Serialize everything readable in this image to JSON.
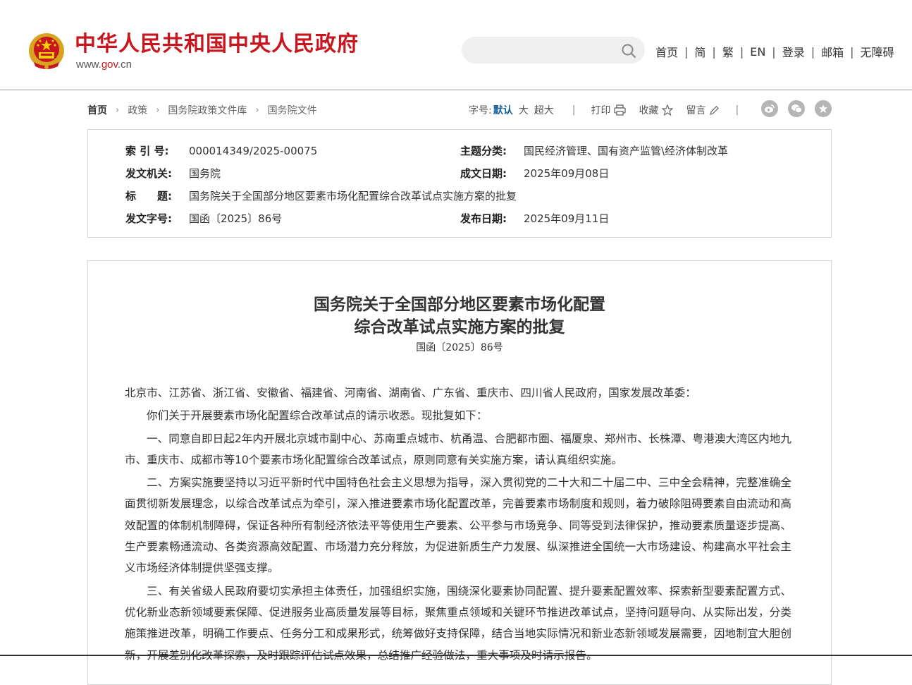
{
  "header": {
    "site_name": "中华人民共和国中央人民政府",
    "url_prefix": "www.",
    "url_gov": "gov",
    "url_suffix": ".cn",
    "search_placeholder": "",
    "nav": [
      "首页",
      "简",
      "繁",
      "EN",
      "登录",
      "邮箱",
      "无障碍"
    ],
    "brand_color": "#c8161e"
  },
  "breadcrumb": [
    "首页",
    "政策",
    "国务院政策文件库",
    "国务院文件"
  ],
  "tools": {
    "font_size_label": "字号:",
    "font_size_default": "默认",
    "font_size_large": "大",
    "font_size_xlarge": "超大",
    "print": "打印",
    "favorite": "收藏",
    "comment": "留言",
    "share_icons": [
      "weibo-icon",
      "wechat-icon",
      "star-share-icon"
    ]
  },
  "meta": {
    "index_no_label": "索 引 号:",
    "index_no": "000014349/2025-00075",
    "topic_label": "主题分类:",
    "topic": "国民经济管理、国有资产监管\\经济体制改革",
    "issuer_label": "发文机关:",
    "issuer": "国务院",
    "written_date_label": "成文日期:",
    "written_date": "2025年09月08日",
    "title_label": "标　　题:",
    "title": "国务院关于全国部分地区要素市场化配置综合改革试点实施方案的批复",
    "doc_no_label": "发文字号:",
    "doc_no": "国函〔2025〕86号",
    "publish_date_label": "发布日期:",
    "publish_date": "2025年09月11日"
  },
  "article": {
    "title_line1": "国务院关于全国部分地区要素市场化配置",
    "title_line2": "综合改革试点实施方案的批复",
    "doc_no": "国函〔2025〕86号",
    "addressee": "北京市、江苏省、浙江省、安徽省、福建省、河南省、湖南省、广东省、重庆市、四川省人民政府，国家发展改革委：",
    "p1": "你们关于开展要素市场化配置综合改革试点的请示收悉。现批复如下：",
    "p2": "一、同意自即日起2年内开展北京城市副中心、苏南重点城市、杭甬温、合肥都市圈、福厦泉、郑州市、长株潭、粤港澳大湾区内地九市、重庆市、成都市等10个要素市场化配置综合改革试点，原则同意有关实施方案，请认真组织实施。",
    "p3": "二、方案实施要坚持以习近平新时代中国特色社会主义思想为指导，深入贯彻党的二十大和二十届二中、三中全会精神，完整准确全面贯彻新发展理念，以综合改革试点为牵引，深入推进要素市场化配置改革，完善要素市场制度和规则，着力破除阻碍要素自由流动和高效配置的体制机制障碍，保证各种所有制经济依法平等使用生产要素、公平参与市场竞争、同等受到法律保护，推动要素质量逐步提高、生产要素畅通流动、各类资源高效配置、市场潜力充分释放，为促进新质生产力发展、纵深推进全国统一大市场建设、构建高水平社会主义市场经济体制提供坚强支撑。",
    "p4": "三、有关省级人民政府要切实承担主体责任，加强组织实施，围绕深化要素协同配置、提升要素配置效率、探索新型要素配置方式、优化新业态新领域要素保障、促进服务业高质量发展等目标，聚焦重点领域和关键环节推进改革试点，坚持问题导向、从实际出发，分类施策推进改革，明确工作要点、任务分工和成果形式，统筹做好支持保障，结合当地实际情况和新业态新领域发展需要，因地制宜大胆创新，开展差别化改革探索，及时跟踪评估试点效果，总结推广经验做法，重大事项及时请示报告。"
  }
}
